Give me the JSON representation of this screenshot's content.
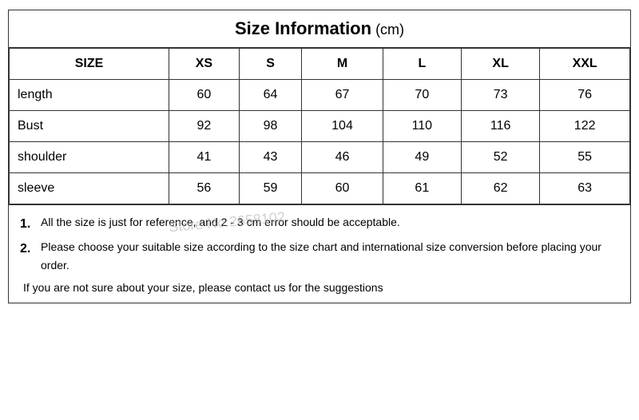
{
  "title": {
    "main": "Size Information",
    "unit": " (cm)"
  },
  "table": {
    "headers": [
      "SIZE",
      "XS",
      "S",
      "M",
      "L",
      "XL",
      "XXL"
    ],
    "rows": [
      {
        "label": "length",
        "values": [
          "60",
          "64",
          "67",
          "70",
          "73",
          "76"
        ]
      },
      {
        "label": "Bust",
        "values": [
          "92",
          "98",
          "104",
          "110",
          "116",
          "122"
        ]
      },
      {
        "label": "shoulder",
        "values": [
          "41",
          "43",
          "46",
          "49",
          "52",
          "55"
        ]
      },
      {
        "label": "sleeve",
        "values": [
          "56",
          "59",
          "60",
          "61",
          "62",
          "63"
        ]
      }
    ]
  },
  "notes": [
    {
      "num": "1.",
      "text": "All the size is just for reference, and 2 - 3 cm error should be acceptable."
    },
    {
      "num": "2.",
      "text": "Please choose your suitable size according to the size chart and international size conversion before placing your order."
    }
  ],
  "extra_note": "If you are not sure about your size, please contact us for the suggestions",
  "watermark": "Store No.2658102"
}
